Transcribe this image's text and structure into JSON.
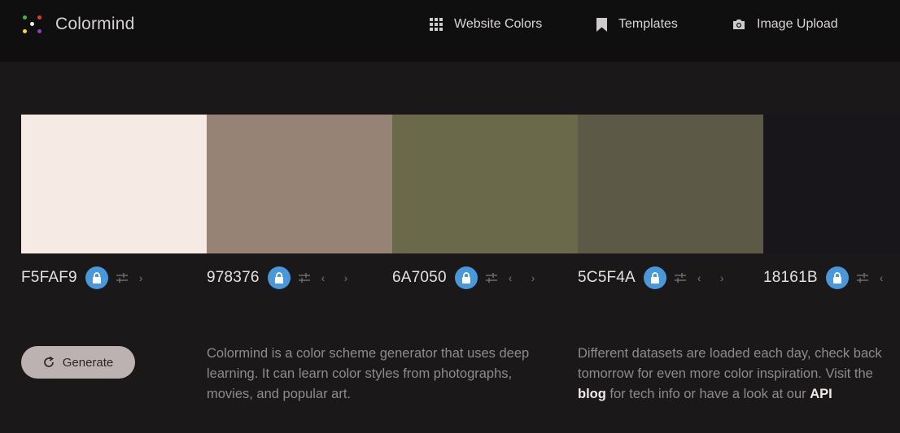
{
  "header": {
    "brand": "Colormind",
    "nav": [
      {
        "label": "Website Colors",
        "icon": "grid-icon"
      },
      {
        "label": "Templates",
        "icon": "bookmark-icon"
      },
      {
        "label": "Image Upload",
        "icon": "camera-icon"
      }
    ]
  },
  "palette": [
    {
      "hex": "F5FAF9",
      "color": "#F5EAE4",
      "prev": false,
      "next": true
    },
    {
      "hex": "978376",
      "color": "#978376",
      "prev": true,
      "next": true
    },
    {
      "hex": "6A7050",
      "color": "#6A6A4A",
      "prev": true,
      "next": true
    },
    {
      "hex": "5C5F4A",
      "color": "#5C5946",
      "prev": true,
      "next": true
    },
    {
      "hex": "18161B",
      "color": "#18161B",
      "prev": true,
      "next": false
    }
  ],
  "actions": {
    "generate_label": "Generate"
  },
  "intro": {
    "text": "Colormind is a color scheme generator that uses deep learning. It can learn color styles from photographs, movies, and popular art."
  },
  "info": {
    "text_before": "Different datasets are loaded each day, check back tomorrow for even more color inspiration. Visit the",
    "blog_link": "blog",
    "text_middle": "for tech info or have a look at our",
    "api_link": "API"
  },
  "colors": {
    "accent": "#4a98d9",
    "button_bg": "#bdb2b2",
    "page_bg": "#1a1819",
    "header_bg": "#0f0f0f"
  }
}
